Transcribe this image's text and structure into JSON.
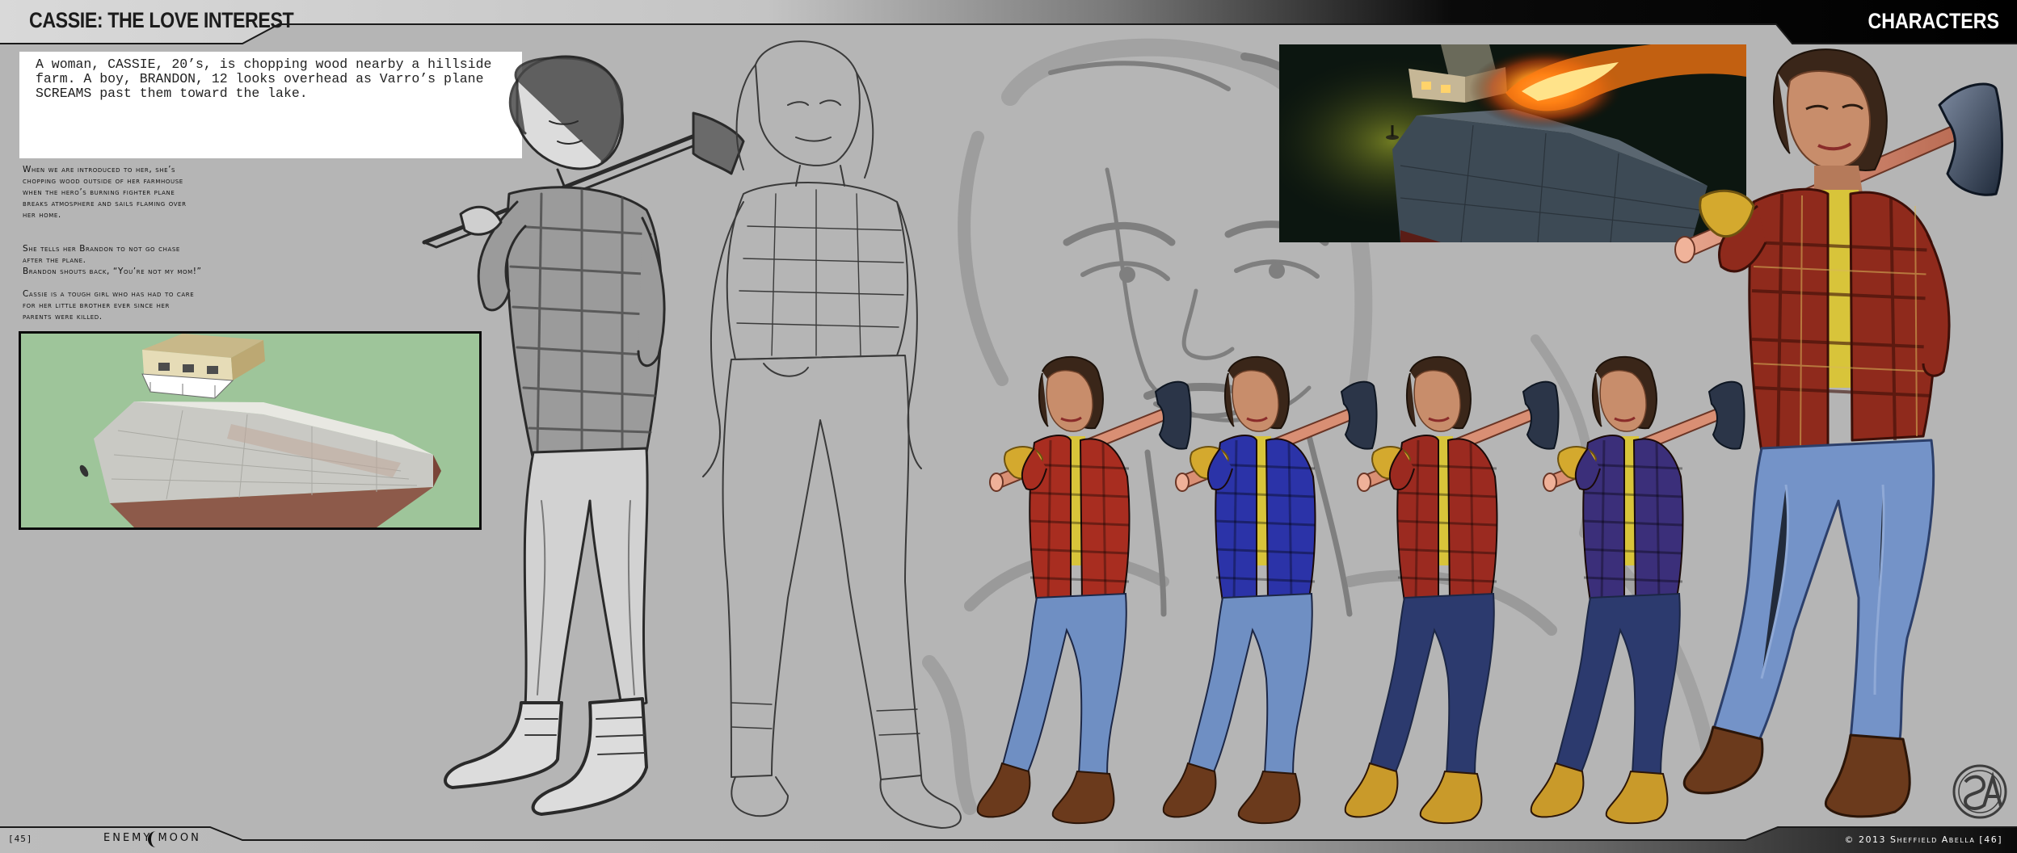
{
  "header": {
    "title": "CASSIE: THE LOVE INTEREST",
    "section": "CHARACTERS"
  },
  "script": {
    "text": "A woman, CASSIE, 20’s, is chopping wood nearby a hillside\nfarm. A boy, BRANDON, 12 looks overhead as Varro’s plane\nSCREAMS past them toward the lake."
  },
  "description": {
    "paragraph_1": "When we are introduced to her, she’s\nchopping wood outside of her farmhouse\nwhen the hero’s burning fighter plane\nbreaks atmosphere and sails flaming over\nher home.",
    "paragraph_2": "She tells her Brandon to not go chase\nafter the plane.",
    "paragraph_3": "Brandon shouts back, “You’re not my mom!”",
    "paragraph_4": "Cassie is a tough girl who has had to care\nfor her little brother ever since her\nparents were killed."
  },
  "footer": {
    "page_left": "[45]",
    "logo_text": "ENEMY MOON",
    "copyright": "© 2013 Sheffield Abella  [46]"
  },
  "colors": {
    "background": "#b5b5b5",
    "header_band": "#000000",
    "layout_green": "#9ec59a",
    "flannel_red": "#9b2a20",
    "flannel_blue": "#2a2f9a",
    "jeans_light": "#6f8fc3",
    "jeans_dark": "#2c3a6e",
    "boots_brown": "#6b3a1c",
    "boots_tan": "#c99a2a"
  },
  "variants": [
    {
      "shirt": "#a82d20",
      "jeans": "#6f8fc3",
      "boots": "#6b3a1c"
    },
    {
      "shirt": "#2b33a8",
      "jeans": "#6f8fc3",
      "boots": "#6b3a1c"
    },
    {
      "shirt": "#9b2a20",
      "jeans": "#2c3a6e",
      "boots": "#c99a2a"
    },
    {
      "shirt": "#3b2f7a",
      "jeans": "#2c3a6e",
      "boots": "#c99a2a"
    }
  ],
  "icons": {
    "logo": "sa-monogram-seal-icon",
    "moon": "crescent-moon-icon"
  }
}
